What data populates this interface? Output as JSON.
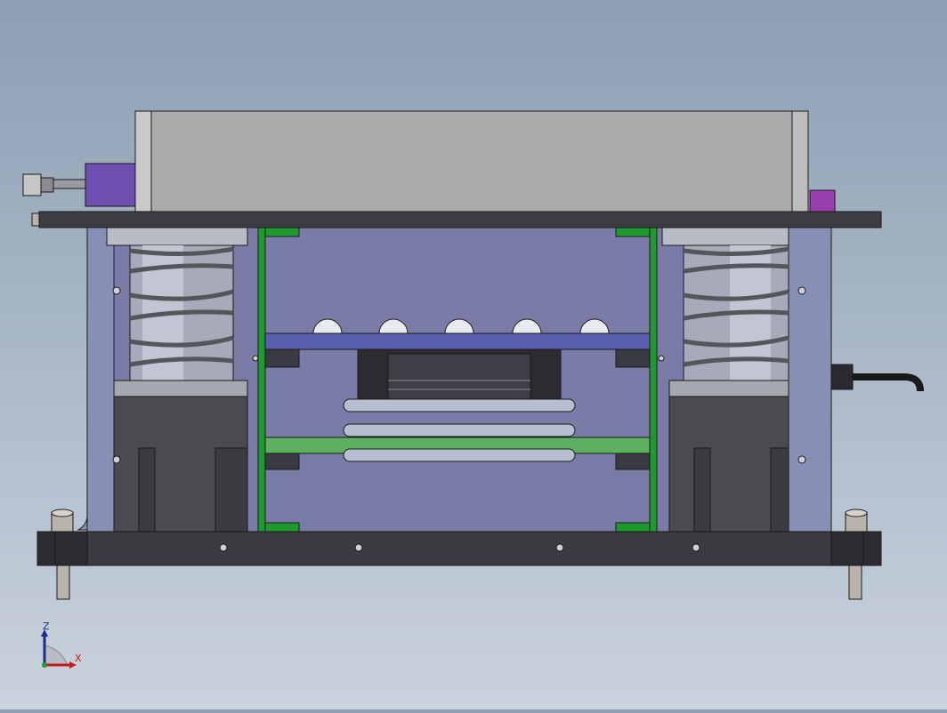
{
  "viewport": {
    "background_top": "#8e9fb2",
    "background_bottom": "#c9d3dd"
  },
  "model": {
    "colors": {
      "outline": "#1a1a1a",
      "enclosure_gray": "#aaaaaa",
      "top_plate": "#3d3d42",
      "base_plate": "#3a3a3f",
      "inner_panel": "#7a7ba6",
      "side_panel": "#8690b5",
      "green_frame": "#1f9a2e",
      "blue_plate": "#5b5fb0",
      "green_plate": "#5fb060",
      "purple_block": "#6e4fb0",
      "magenta_block": "#9a3fb0",
      "motor_dark": "#4a4a50",
      "fan_dark": "#2b2b30",
      "spring": "#5a5a60",
      "sphere": "#e8eaf0",
      "cable": "#1a1a1a"
    }
  },
  "triad": {
    "z_label": "Z",
    "x_label": "X",
    "z_color": "#1b2a8c",
    "x_color": "#c41a1a"
  }
}
